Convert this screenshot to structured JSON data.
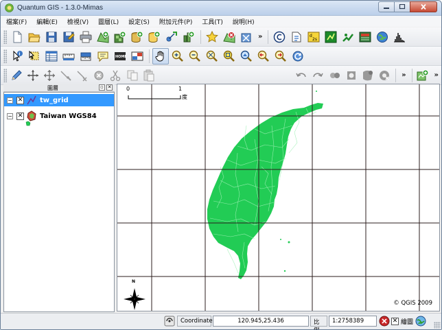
{
  "window": {
    "title": "Quantum GIS - 1.3.0-Mimas"
  },
  "menu": [
    {
      "id": "file",
      "label": "檔案(F)"
    },
    {
      "id": "edit",
      "label": "編輯(E)"
    },
    {
      "id": "view",
      "label": "檢視(V)"
    },
    {
      "id": "layer",
      "label": "圖層(L)"
    },
    {
      "id": "settings",
      "label": "設定(S)"
    },
    {
      "id": "plugins",
      "label": "附加元件(P)"
    },
    {
      "id": "tools",
      "label": "工具(T)"
    },
    {
      "id": "help",
      "label": "說明(H)"
    }
  ],
  "toolbars": {
    "row1": [
      "new-project-icon",
      "open-project-icon",
      "save-project-icon",
      "save-as-icon",
      "print-icon",
      "add-vector-layer-icon",
      "add-raster-layer-icon",
      "add-postgis-layer-icon",
      "add-spatialite-layer-icon",
      "new-vector-layer-icon",
      "add-wms-layer-icon",
      "remove-layer-icon",
      "overview-icon",
      "remove-all-overview-icon",
      "copyright-icon",
      "north-arrow-icon",
      "scale-bar-icon",
      "grass-icon",
      "georeferencer-icon",
      "gps-icon",
      "histogram-icon"
    ],
    "row2": [
      "identify-icon",
      "select-icon",
      "attribute-table-icon",
      "measure-line-icon",
      "measure-area-icon",
      "map-tips-icon",
      "home-bookmark-icon",
      "new-bookmark-icon",
      "pan-icon",
      "zoom-in-icon",
      "zoom-out-icon",
      "zoom-full-icon",
      "zoom-selection-icon",
      "zoom-layer-icon",
      "zoom-last-icon",
      "zoom-next-icon",
      "refresh-icon"
    ],
    "row3": [
      "toggle-editing-icon",
      "capture-point-icon",
      "move-feature-icon",
      "add-vertex-icon",
      "delete-vertex-icon",
      "delete-selected-icon",
      "cut-features-icon",
      "copy-features-icon",
      "paste-features-icon",
      "undo-icon",
      "redo-icon",
      "simplify-icon",
      "add-ring-icon",
      "add-island-icon",
      "delete-ring-icon",
      "split-icon",
      "plugin-icon"
    ]
  },
  "layers_panel": {
    "title": "圖層",
    "layers": [
      {
        "name": "tw_grid",
        "checked": true,
        "selected": true,
        "expander": "−",
        "icon": "line-layer-icon"
      },
      {
        "name": "Taiwan WGS84",
        "checked": true,
        "selected": false,
        "expander": "−",
        "icon": "polygon-layer-icon"
      }
    ]
  },
  "map": {
    "scale_labels": [
      "0",
      "1"
    ],
    "scale_unit": "度",
    "north_label": "N",
    "copyright": "© QGIS 2009",
    "colors": {
      "land": "#22cc55",
      "boundary": "#9ff0b5",
      "grid": "#2b1c1c"
    }
  },
  "status": {
    "coordinate_label": "Coordinate:",
    "coordinate_value": "120.945,25.436",
    "scale_label": "比例",
    "scale_value": "1:2758389",
    "render_label": "繪圖",
    "render_checked": true
  }
}
